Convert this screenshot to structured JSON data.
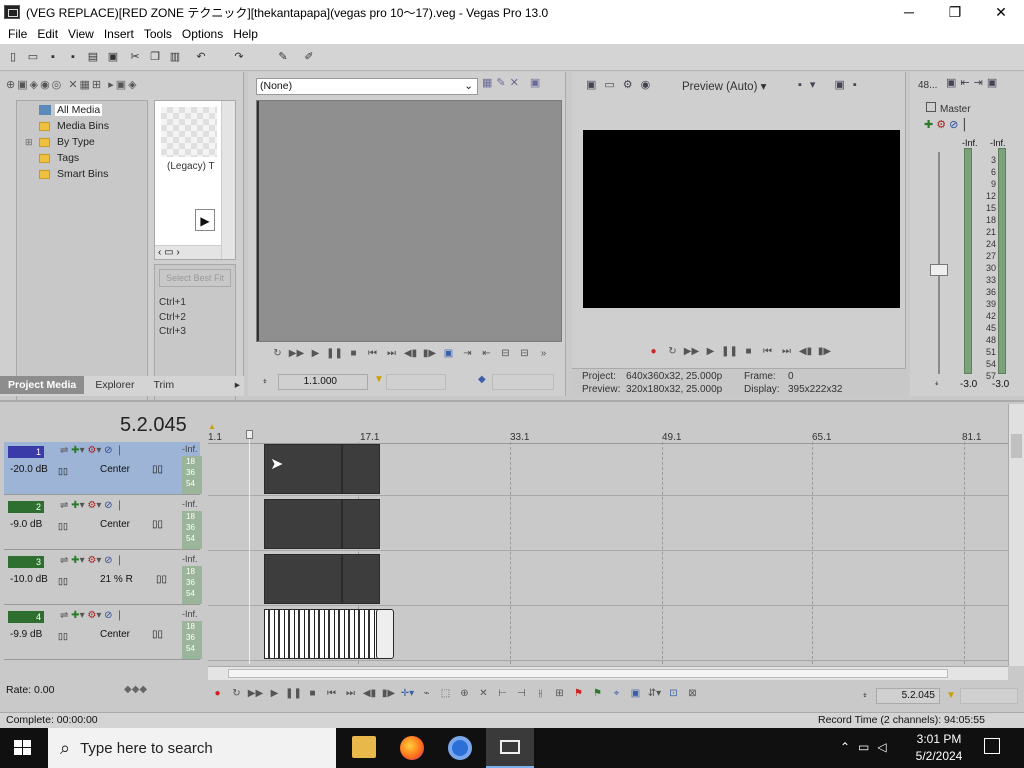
{
  "window": {
    "title": "(VEG REPLACE)[RED ZONE テクニック][thekantapapa](vegas pro 10〜17).veg - Vegas Pro 13.0",
    "minimize": "─",
    "maximize": "❐",
    "close": "✕"
  },
  "menu": [
    "File",
    "Edit",
    "View",
    "Insert",
    "Tools",
    "Options",
    "Help"
  ],
  "media": {
    "tree": [
      "All Media",
      "Media Bins",
      "By Type",
      "Tags",
      "Smart Bins"
    ],
    "thumb_label": "(Legacy) T",
    "shortcuts": [
      "Ctrl+1",
      "Ctrl+2",
      "Ctrl+3"
    ],
    "select_btn": "Select Best Fit",
    "tabs": [
      "Project Media",
      "Explorer",
      "Trim"
    ]
  },
  "trimmer": {
    "dropdown": "(None)",
    "timecode": "1.1.000"
  },
  "preview": {
    "mode": "Preview (Auto)",
    "project_label": "Project:",
    "project_val": "640x360x32, 25.000p",
    "preview_label": "Preview:",
    "preview_val": "320x180x32, 25.000p",
    "frame_label": "Frame:",
    "frame_val": "0",
    "display_label": "Display:",
    "display_val": "395x222x32"
  },
  "master": {
    "label": "Master",
    "header": "48...",
    "inf_l": "-Inf.",
    "inf_r": "-Inf.",
    "scale": [
      "3",
      "6",
      "9",
      "12",
      "15",
      "18",
      "21",
      "24",
      "27",
      "30",
      "33",
      "36",
      "39",
      "42",
      "45",
      "48",
      "51",
      "54",
      "57"
    ],
    "left_val": "-3.0",
    "right_val": "-3.0"
  },
  "timeline": {
    "timecode": "5.2.045",
    "ruler": [
      "1.1",
      "17.1",
      "33.1",
      "49.1",
      "65.1",
      "81.1"
    ],
    "tracks": [
      {
        "num": "1",
        "db": "-20.0 dB",
        "pan": "Center",
        "inf": "-Inf.",
        "meter": [
          "18",
          "36",
          "54"
        ]
      },
      {
        "num": "2",
        "db": "-9.0 dB",
        "pan": "Center",
        "inf": "-Inf.",
        "meter": [
          "18",
          "36",
          "54"
        ]
      },
      {
        "num": "3",
        "db": "-10.0 dB",
        "pan": "21 % R",
        "inf": "-Inf.",
        "meter": [
          "18",
          "36",
          "54"
        ]
      },
      {
        "num": "4",
        "db": "-9.9 dB",
        "pan": "Center",
        "inf": "-Inf.",
        "meter": [
          "18",
          "36",
          "54"
        ]
      }
    ],
    "rate": "Rate: 0.00",
    "cursor_time": "5.2.045"
  },
  "status": {
    "left": "Complete: 00:00:00",
    "right": "Record Time (2 channels): 94:05:55"
  },
  "taskbar": {
    "search": "Type here to search",
    "time": "3:01 PM",
    "date": "5/2/2024"
  },
  "colors": {
    "track_selected": "#9db4d6",
    "taskbar": "#101010",
    "preview": "#000000"
  }
}
